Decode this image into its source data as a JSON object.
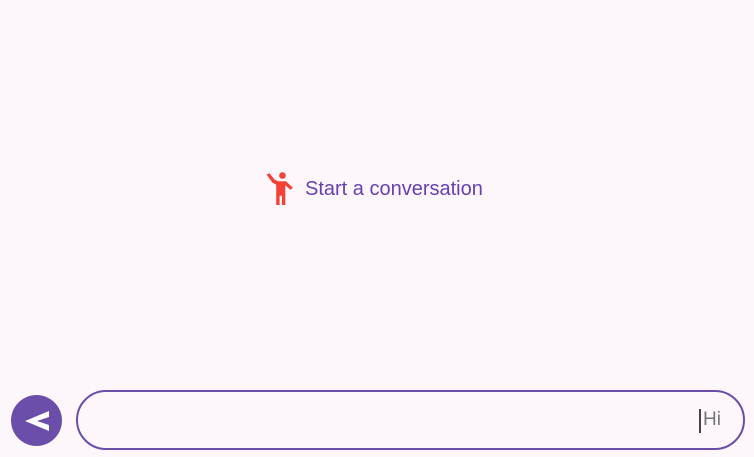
{
  "empty_state": {
    "icon": "person-waving-icon",
    "text": "Start a conversation"
  },
  "composer": {
    "send_icon": "send-arrow-icon",
    "input_value": "",
    "input_placeholder": "Hi"
  },
  "colors": {
    "background": "#fdf7fc",
    "accent": "#6a4eaa",
    "text_accent": "#6741b3",
    "wave_icon": "#f44336"
  }
}
